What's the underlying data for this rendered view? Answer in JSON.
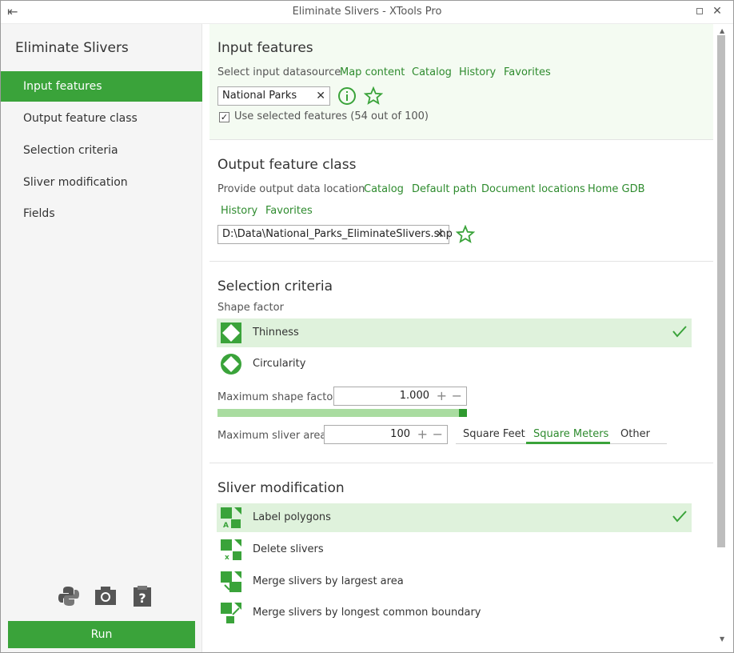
{
  "window": {
    "title": "Eliminate Slivers - XTools Pro"
  },
  "sidebar": {
    "app_title": "Eliminate Slivers",
    "items": [
      {
        "label": "Input features",
        "active": true
      },
      {
        "label": "Output feature class"
      },
      {
        "label": "Selection criteria"
      },
      {
        "label": "Sliver modification"
      },
      {
        "label": "Fields"
      }
    ],
    "tools": [
      "python-icon",
      "camera-icon",
      "help-clipboard-icon"
    ],
    "run_label": "Run"
  },
  "input": {
    "heading": "Input features",
    "datasource_label": "Select input datasource",
    "links": [
      "Map content",
      "Catalog",
      "History",
      "Favorites"
    ],
    "value": "National Parks",
    "use_selected": "Use selected features (54 out of 100)",
    "use_selected_checked": true
  },
  "output": {
    "heading": "Output feature class",
    "location_label": "Provide output data location",
    "links": [
      "Catalog",
      "Default path",
      "Document locations",
      "Home GDB",
      "History",
      "Favorites"
    ],
    "value": "D:\\Data\\National_Parks_EliminateSlivers.shp"
  },
  "selection": {
    "heading": "Selection criteria",
    "shape_factor_label": "Shape factor",
    "options": [
      {
        "label": "Thinness",
        "selected": true
      },
      {
        "label": "Circularity",
        "selected": false
      }
    ],
    "max_shape_label": "Maximum shape factor",
    "max_shape_value": "1.000",
    "max_shape_fraction": 1.0,
    "max_area_label": "Maximum sliver area",
    "max_area_value": "100",
    "units": [
      "Square Feet",
      "Square Meters",
      "Other"
    ],
    "active_unit": "Square Meters"
  },
  "modification": {
    "heading": "Sliver modification",
    "options": [
      {
        "label": "Label polygons",
        "selected": true
      },
      {
        "label": "Delete slivers",
        "selected": false
      },
      {
        "label": "Merge slivers by largest area",
        "selected": false
      },
      {
        "label": "Merge slivers by longest common boundary",
        "selected": false
      }
    ]
  },
  "colors": {
    "accent": "#3aa33a",
    "selected_row": "#dff2dc",
    "link": "#2e8b2e"
  }
}
